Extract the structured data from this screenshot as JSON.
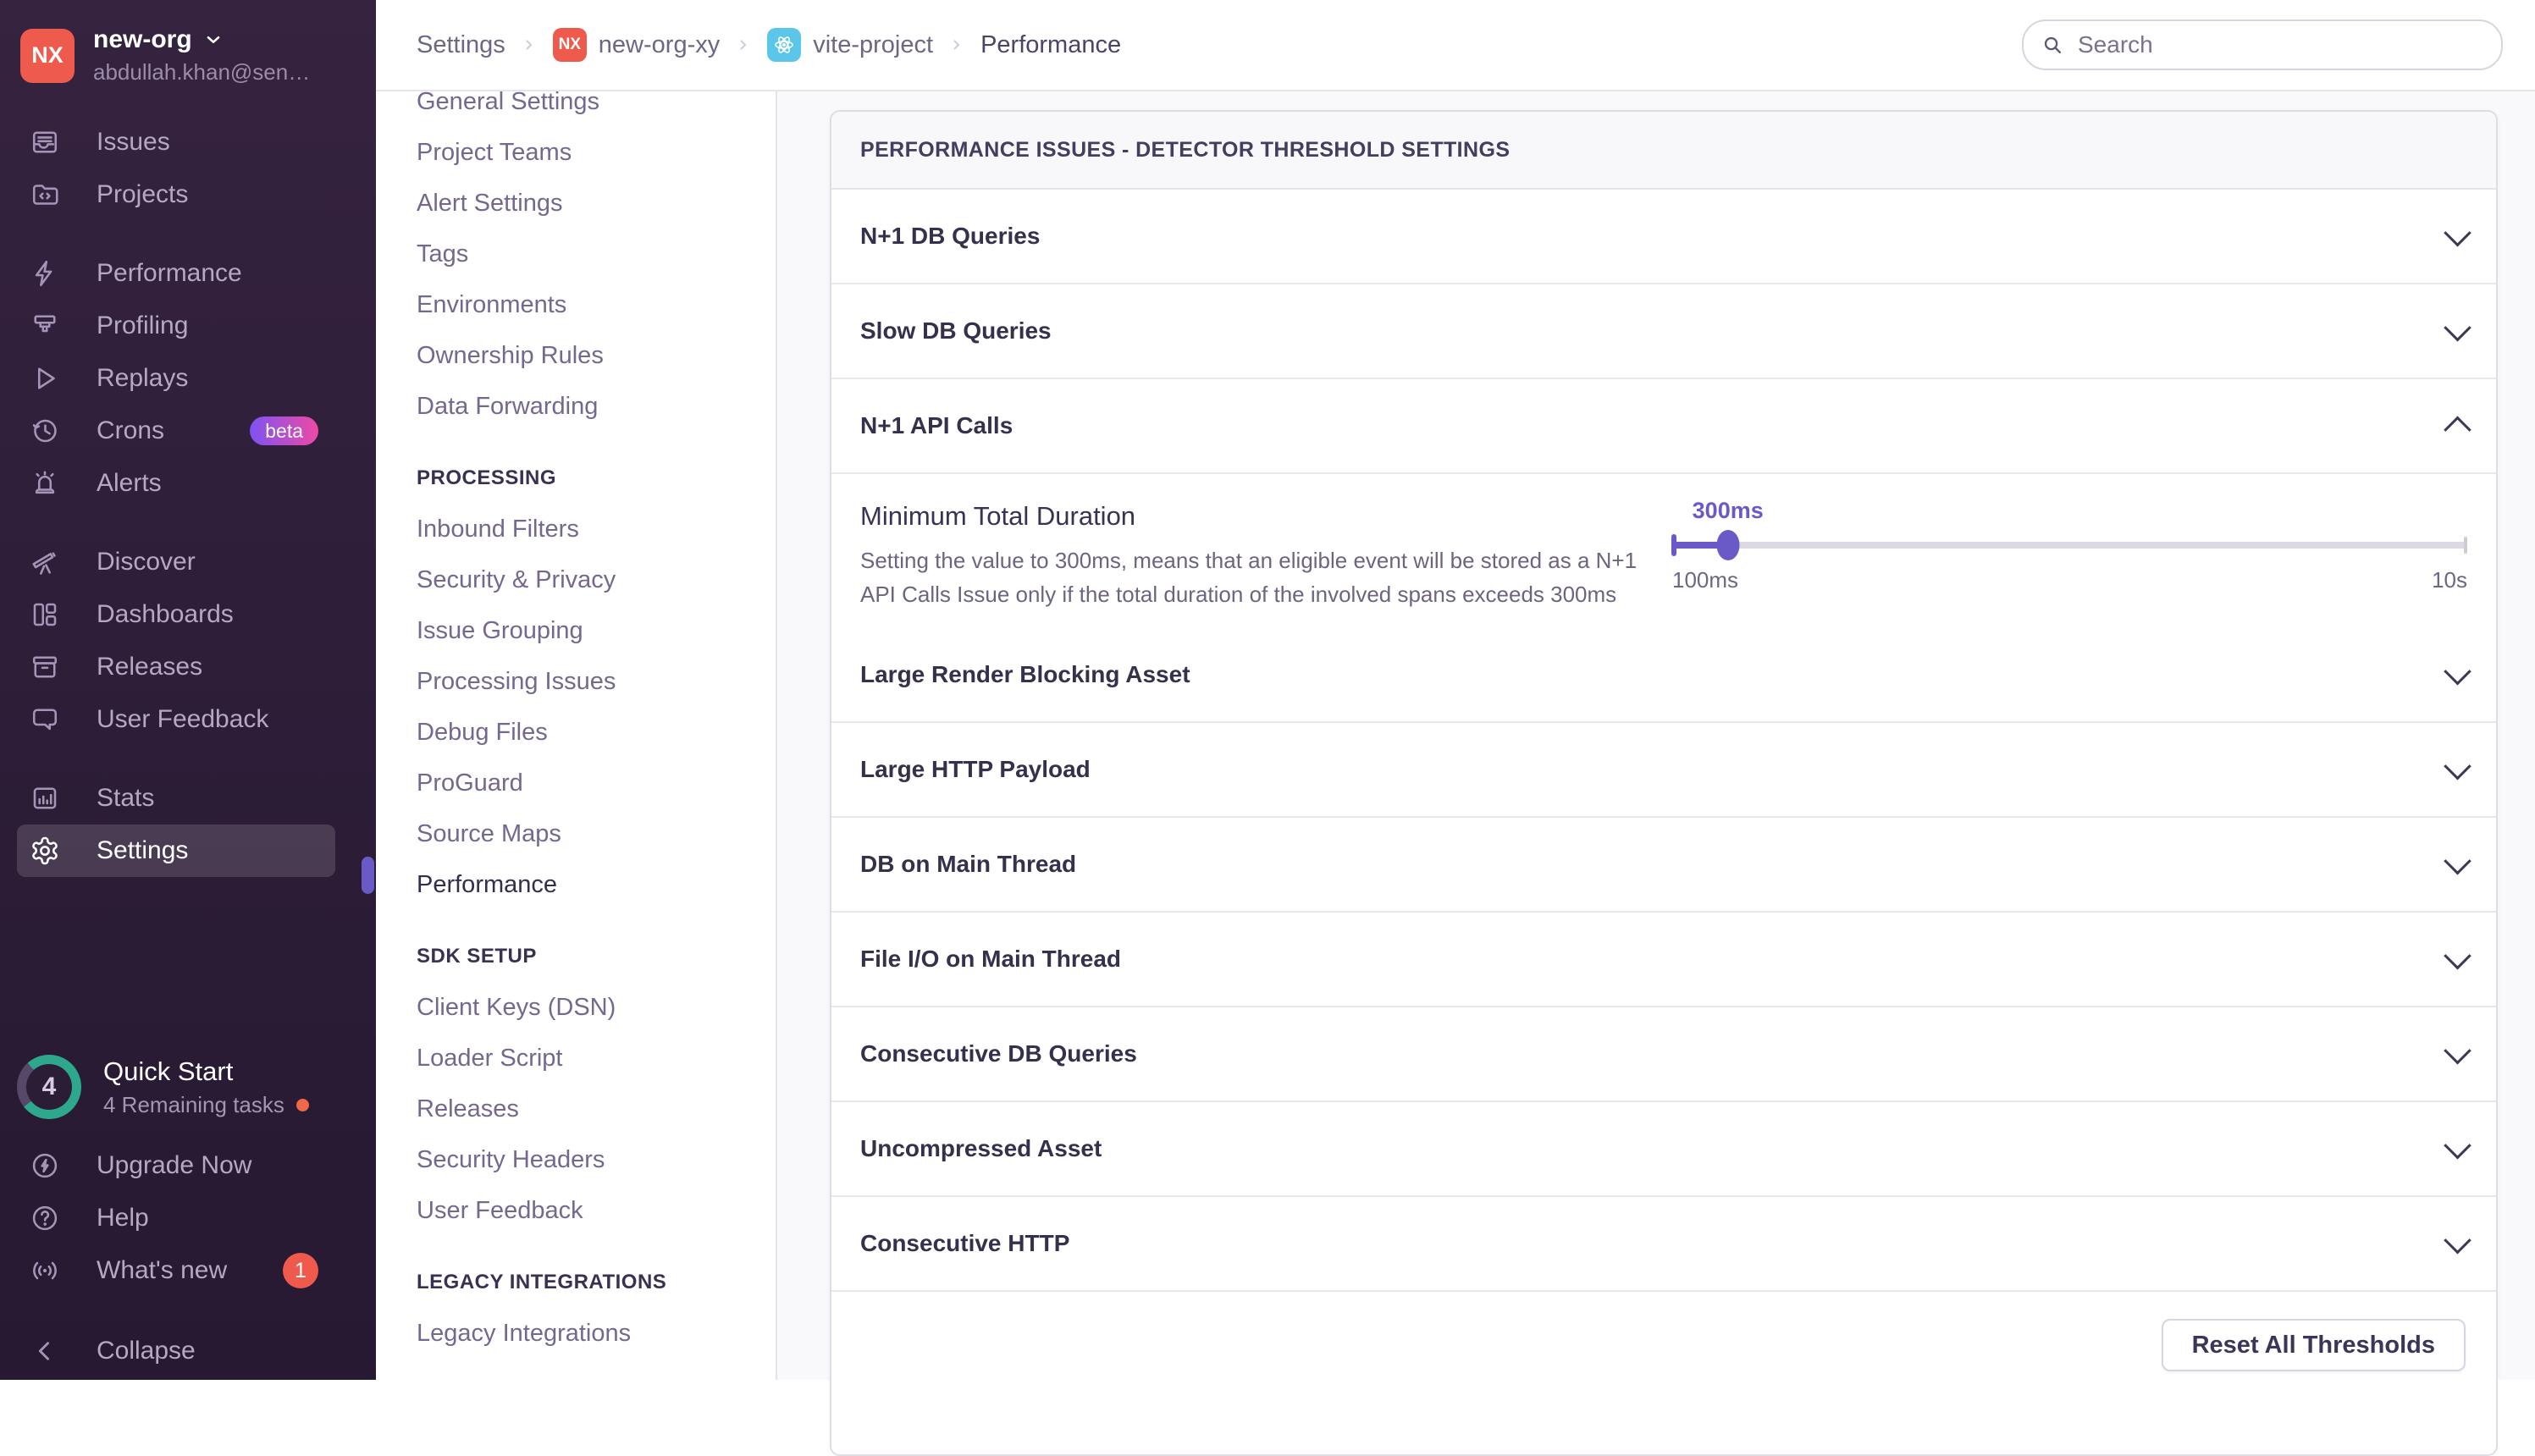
{
  "colors": {
    "accent_purple": "#6a5ac8",
    "org_avatar": "#ee5a4b",
    "beta_gradient_start": "#7d53f2",
    "beta_gradient_end": "#ee4aa5",
    "notification_red": "#ef5a4c",
    "progress_teal": "#2ea88c",
    "task_dot_orange": "#ef6847",
    "react_chip": "#5bc6ea"
  },
  "sidebar": {
    "org_initials": "NX",
    "org_name": "new-org",
    "user_email": "abdullah.khan@sen…",
    "beta_label": "beta",
    "items": [
      {
        "label": "Issues"
      },
      {
        "label": "Projects"
      },
      {
        "label": "Performance"
      },
      {
        "label": "Profiling"
      },
      {
        "label": "Replays"
      },
      {
        "label": "Crons"
      },
      {
        "label": "Alerts"
      },
      {
        "label": "Discover"
      },
      {
        "label": "Dashboards"
      },
      {
        "label": "Releases"
      },
      {
        "label": "User Feedback"
      },
      {
        "label": "Stats"
      },
      {
        "label": "Settings"
      }
    ],
    "quick_start": {
      "title": "Quick Start",
      "subtitle": "4 Remaining tasks",
      "count": "4"
    },
    "footer_items": [
      {
        "label": "Upgrade Now"
      },
      {
        "label": "Help"
      },
      {
        "label": "What's new",
        "badge": "1"
      }
    ],
    "collapse_label": "Collapse"
  },
  "topbar": {
    "breadcrumbs": [
      {
        "label": "Settings"
      },
      {
        "label": "new-org-xy",
        "chip": "NX"
      },
      {
        "label": "vite-project"
      },
      {
        "label": "Performance"
      }
    ],
    "search_placeholder": "Search"
  },
  "settings_nav": {
    "sections": [
      {
        "header": "",
        "items": [
          "General Settings",
          "Project Teams",
          "Alert Settings",
          "Tags",
          "Environments",
          "Ownership Rules",
          "Data Forwarding"
        ]
      },
      {
        "header": "PROCESSING",
        "items": [
          "Inbound Filters",
          "Security & Privacy",
          "Issue Grouping",
          "Processing Issues",
          "Debug Files",
          "ProGuard",
          "Source Maps",
          "Performance"
        ]
      },
      {
        "header": "SDK SETUP",
        "items": [
          "Client Keys (DSN)",
          "Loader Script",
          "Releases",
          "Security Headers",
          "User Feedback"
        ]
      },
      {
        "header": "LEGACY INTEGRATIONS",
        "items": [
          "Legacy Integrations"
        ]
      }
    ]
  },
  "panel": {
    "title": "PERFORMANCE ISSUES - DETECTOR THRESHOLD SETTINGS",
    "rows": [
      "N+1 DB Queries",
      "Slow DB Queries",
      "N+1 API Calls",
      "Large Render Blocking Asset",
      "Large HTTP Payload",
      "DB on Main Thread",
      "File I/O on Main Thread",
      "Consecutive DB Queries",
      "Uncompressed Asset",
      "Consecutive HTTP"
    ],
    "detail": {
      "title": "Minimum Total Duration",
      "description": "Setting the value to 300ms, means that an eligible event will be stored as a N+1 API Calls Issue only if the total duration of the involved spans exceeds 300ms",
      "slider": {
        "value": "300ms",
        "min": "100ms",
        "max": "10s",
        "percent": 7
      }
    },
    "reset_button": "Reset All Thresholds"
  }
}
